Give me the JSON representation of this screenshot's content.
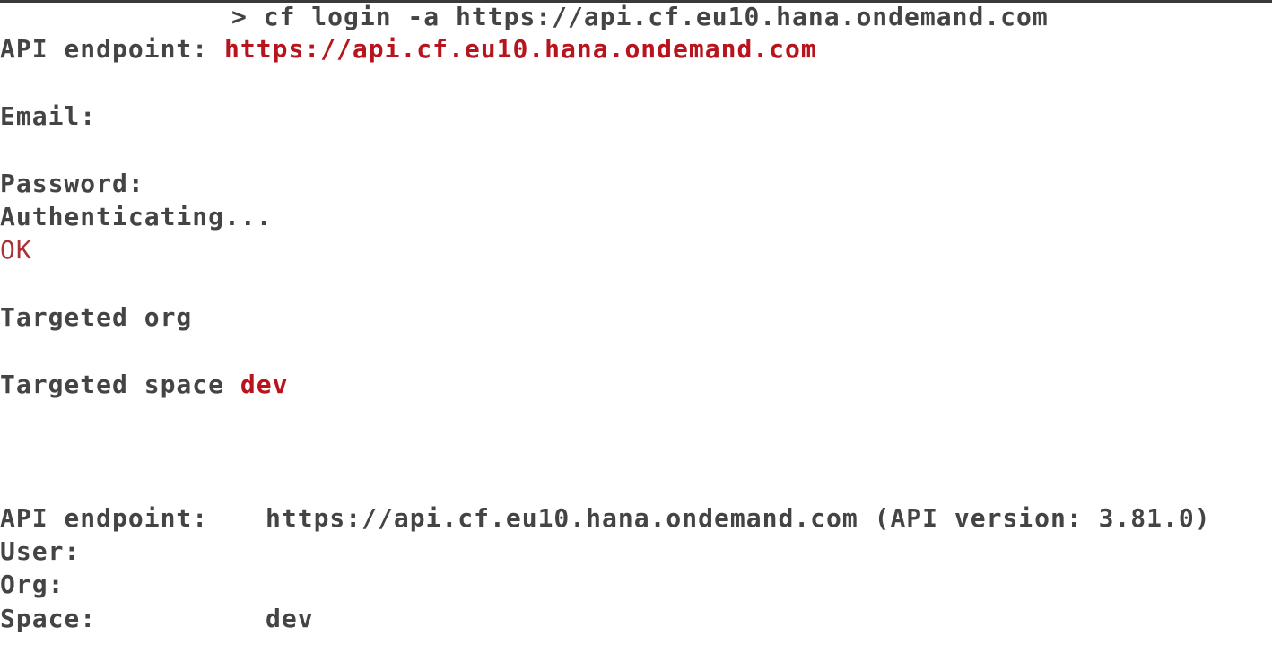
{
  "colors": {
    "text": "#444444",
    "highlight": "#b8141e",
    "background": "#ffffff"
  },
  "terminal": {
    "command_prefix": "> ",
    "command": "cf login -a https://api.cf.eu10.hana.ondemand.com",
    "api_endpoint_label": "API endpoint: ",
    "api_endpoint_value": "https://api.cf.eu10.hana.ondemand.com",
    "email_prompt": "Email:",
    "password_prompt": "Password:",
    "authenticating": "Authenticating...",
    "ok": "OK",
    "targeted_org": "Targeted org",
    "targeted_space_label": "Targeted space ",
    "targeted_space_value": "dev",
    "summary": {
      "api_endpoint_label": "API endpoint:",
      "api_endpoint_value": "https://api.cf.eu10.hana.ondemand.com (API version: 3.81.0)",
      "user_label": "User:",
      "user_value": "",
      "org_label": "Org:",
      "org_value": "",
      "space_label": "Space:",
      "space_value": "dev"
    }
  }
}
